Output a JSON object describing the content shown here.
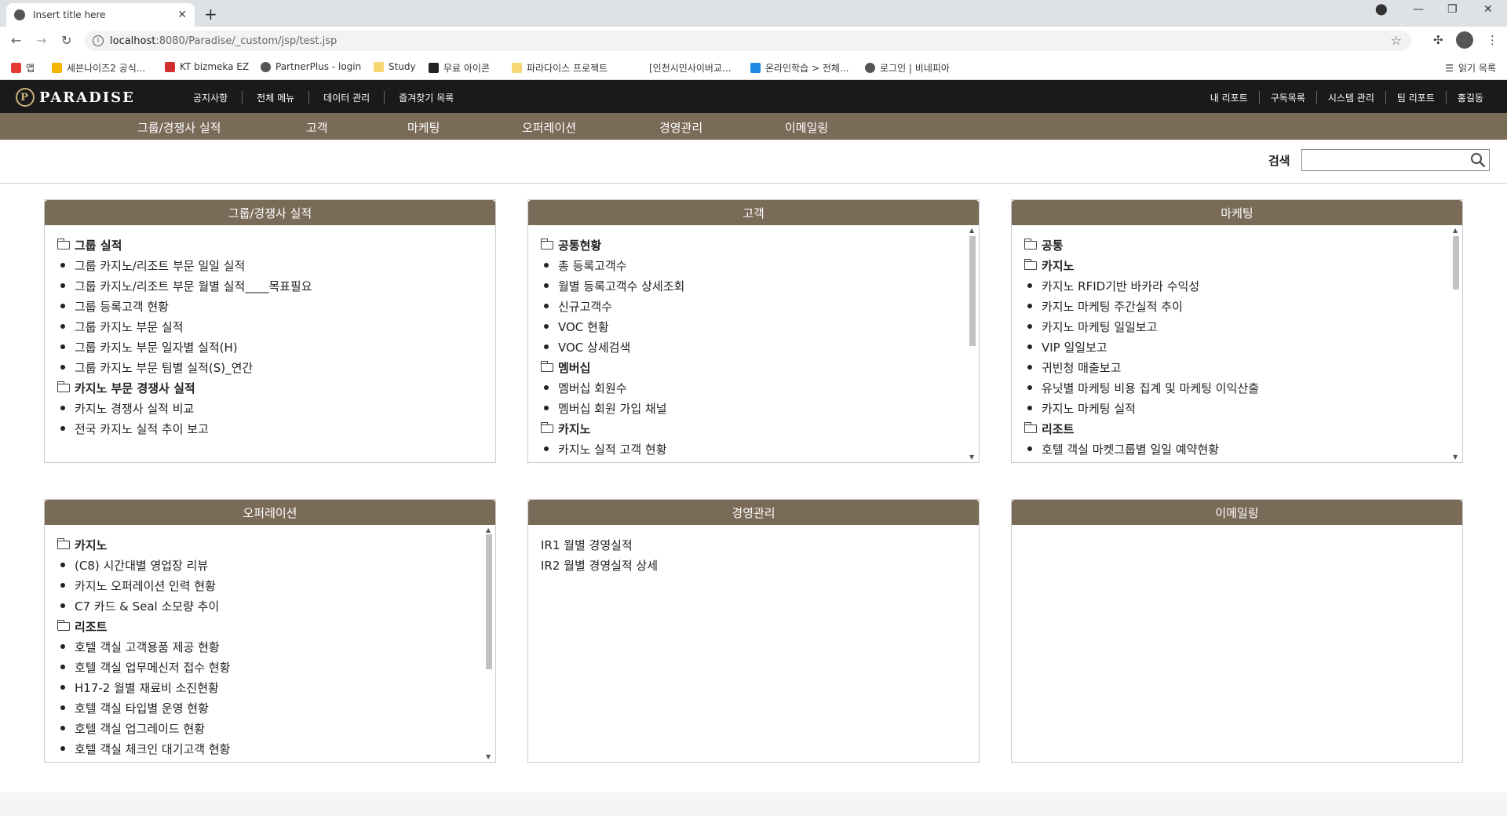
{
  "browser": {
    "tab_title": "Insert title here",
    "url_host": "localhost",
    "url_path": ":8080/Paradise/_custom/jsp/test.jsp",
    "bookmarks": [
      {
        "label": "앱",
        "color": "#e53935"
      },
      {
        "label": "세븐나이즈2 공식...",
        "color": "#f4b400"
      },
      {
        "label": "KT bizmeka EZ",
        "color": "#d32f2f"
      },
      {
        "label": "PartnerPlus - login",
        "color": "#555555"
      },
      {
        "label": "Study",
        "color": "#f7d774"
      },
      {
        "label": "무료 아이콘",
        "color": "#222222"
      },
      {
        "label": "파라다이스 프로젝트",
        "color": "#f7d774"
      },
      {
        "label": "[인천시민사이버교...",
        "color": "#ffffff"
      },
      {
        "label": "온라인학습 > 전체...",
        "color": "#1e88e5"
      },
      {
        "label": "로그인 | 비네피아",
        "color": "#555555"
      }
    ],
    "reading_list": "읽기 목록"
  },
  "header": {
    "logo": "PARADISE",
    "top_menu": [
      "공지사항",
      "전체 메뉴",
      "데이터 관리",
      "즐겨찾기 목록"
    ],
    "right_menu": [
      "내 리포트",
      "구독목록",
      "시스템 관리",
      "팀 리포트",
      "홍길동"
    ]
  },
  "main_nav": [
    "그룹/경쟁사 실적",
    "고객",
    "마케팅",
    "오퍼레이션",
    "경영관리",
    "이메일링"
  ],
  "search": {
    "label": "검색",
    "value": ""
  },
  "panels": [
    {
      "title": "그룹/경쟁사 실적",
      "items": [
        {
          "type": "folder",
          "text": "그룹 실적"
        },
        {
          "type": "item",
          "text": "그룹 카지노/리조트 부문 일일 실적"
        },
        {
          "type": "item",
          "text": "그룹 카지노/리조트 부문 월별 실적____목표필요"
        },
        {
          "type": "item",
          "text": "그룹 등록고객 현황"
        },
        {
          "type": "item",
          "text": "그룹 카지노 부문 실적"
        },
        {
          "type": "item",
          "text": "그룹 카지노 부문 일자별 실적(H)"
        },
        {
          "type": "item",
          "text": "그룹 카지노 부문 팀별 실적(S)_연간"
        },
        {
          "type": "folder",
          "text": "카지노 부문 경쟁사 실적"
        },
        {
          "type": "item",
          "text": "카지노 경쟁사 실적 비교"
        },
        {
          "type": "item",
          "text": "전국 카지노 실적 추이 보고"
        }
      ]
    },
    {
      "title": "고객",
      "items": [
        {
          "type": "folder",
          "text": "공통현황"
        },
        {
          "type": "item",
          "text": "총 등록고객수"
        },
        {
          "type": "item",
          "text": "월별 등록고객수 상세조회"
        },
        {
          "type": "item",
          "text": "신규고객수"
        },
        {
          "type": "item",
          "text": "VOC 현황"
        },
        {
          "type": "item",
          "text": "VOC 상세검색"
        },
        {
          "type": "folder",
          "text": "멤버십"
        },
        {
          "type": "item",
          "text": "멤버십 회원수"
        },
        {
          "type": "item",
          "text": "멤버십 회원 가입 채널"
        },
        {
          "type": "folder",
          "text": "카지노"
        },
        {
          "type": "item",
          "text": "카지노 실적 고객 현황"
        }
      ]
    },
    {
      "title": "마케팅",
      "items": [
        {
          "type": "folder",
          "text": "공통"
        },
        {
          "type": "folder",
          "text": "카지노"
        },
        {
          "type": "item",
          "text": "카지노 RFID기반 바카라 수익성"
        },
        {
          "type": "item",
          "text": "카지노 마케팅 주간실적 추이"
        },
        {
          "type": "item",
          "text": "카지노 마케팅 일일보고"
        },
        {
          "type": "item",
          "text": "VIP 일일보고"
        },
        {
          "type": "item",
          "text": "귀빈청 매출보고"
        },
        {
          "type": "item",
          "text": "유닛별 마케팅 비용 집계 및 마케팅 이익산출"
        },
        {
          "type": "item",
          "text": "카지노 마케팅 실적"
        },
        {
          "type": "folder",
          "text": "리조트"
        },
        {
          "type": "item",
          "text": "호텔 객실 마켓그룹별 일일 예약현황"
        }
      ]
    },
    {
      "title": "오퍼레이션",
      "items": [
        {
          "type": "folder",
          "text": "카지노"
        },
        {
          "type": "item",
          "text": "(C8) 시간대별 영업장 리뷰"
        },
        {
          "type": "item",
          "text": "카지노 오퍼레이션 인력 현황"
        },
        {
          "type": "item",
          "text": "C7 카드 & Seal 소모량 추이"
        },
        {
          "type": "folder",
          "text": "리조트"
        },
        {
          "type": "item",
          "text": "호텔 객실 고객용품 제공 현황"
        },
        {
          "type": "item",
          "text": "호텔 객실 업무메신저 접수 현황"
        },
        {
          "type": "item",
          "text": "H17-2 월별 재료비 소진현황"
        },
        {
          "type": "item",
          "text": "호텔 객실 타입별 운영 현황"
        },
        {
          "type": "item",
          "text": "호텔 객실 업그레이드 현황"
        },
        {
          "type": "item",
          "text": "호텔 객실 체크인 대기고객 현황"
        }
      ]
    },
    {
      "title": "경영관리",
      "items": [
        {
          "type": "plain",
          "text": "IR1 월별 경영실적"
        },
        {
          "type": "plain",
          "text": "IR2 월별 경영실적 상세"
        }
      ]
    },
    {
      "title": "이메일링",
      "items": []
    }
  ],
  "colors": {
    "header_bg": "#1a1a1a",
    "brown": "#7a6a58",
    "logo_gold": "#c9b27a"
  }
}
